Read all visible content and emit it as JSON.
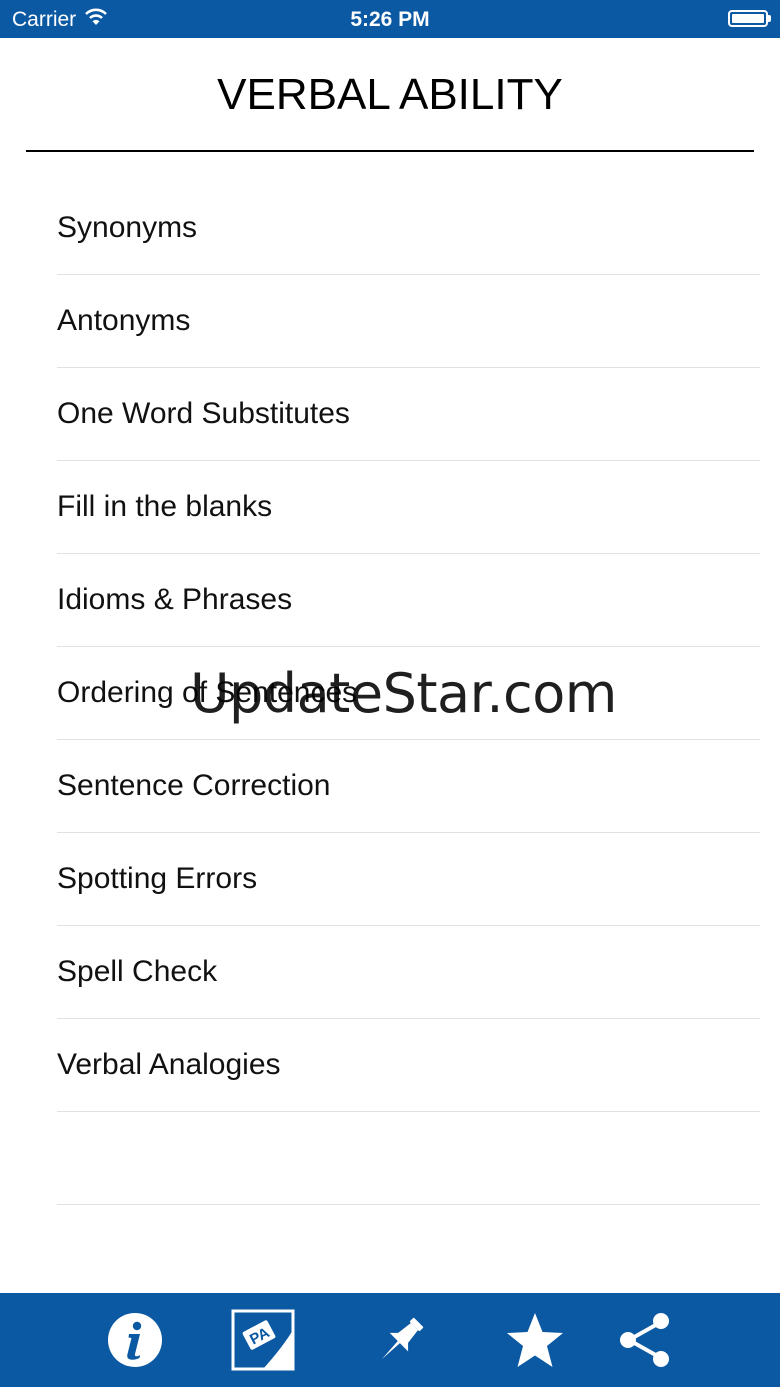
{
  "status_bar": {
    "carrier": "Carrier",
    "time": "5:26 PM",
    "battery_level": 1.0
  },
  "header": {
    "title": "VERBAL ABILITY"
  },
  "menu": {
    "items": [
      "Synonyms",
      "Antonyms",
      "One Word Substitutes",
      "Fill in the blanks",
      "Idioms & Phrases",
      "Ordering of Sentences",
      "Sentence Correction",
      "Spotting Errors",
      "Spell Check",
      "Verbal Analogies"
    ]
  },
  "watermark": "UpdateStar.com",
  "tab_bar": {
    "color": "#0b58a3",
    "icons": [
      "info-icon",
      "pa-logo-icon",
      "pin-icon",
      "star-icon",
      "share-icon"
    ],
    "pa_logo_text": "PA"
  }
}
